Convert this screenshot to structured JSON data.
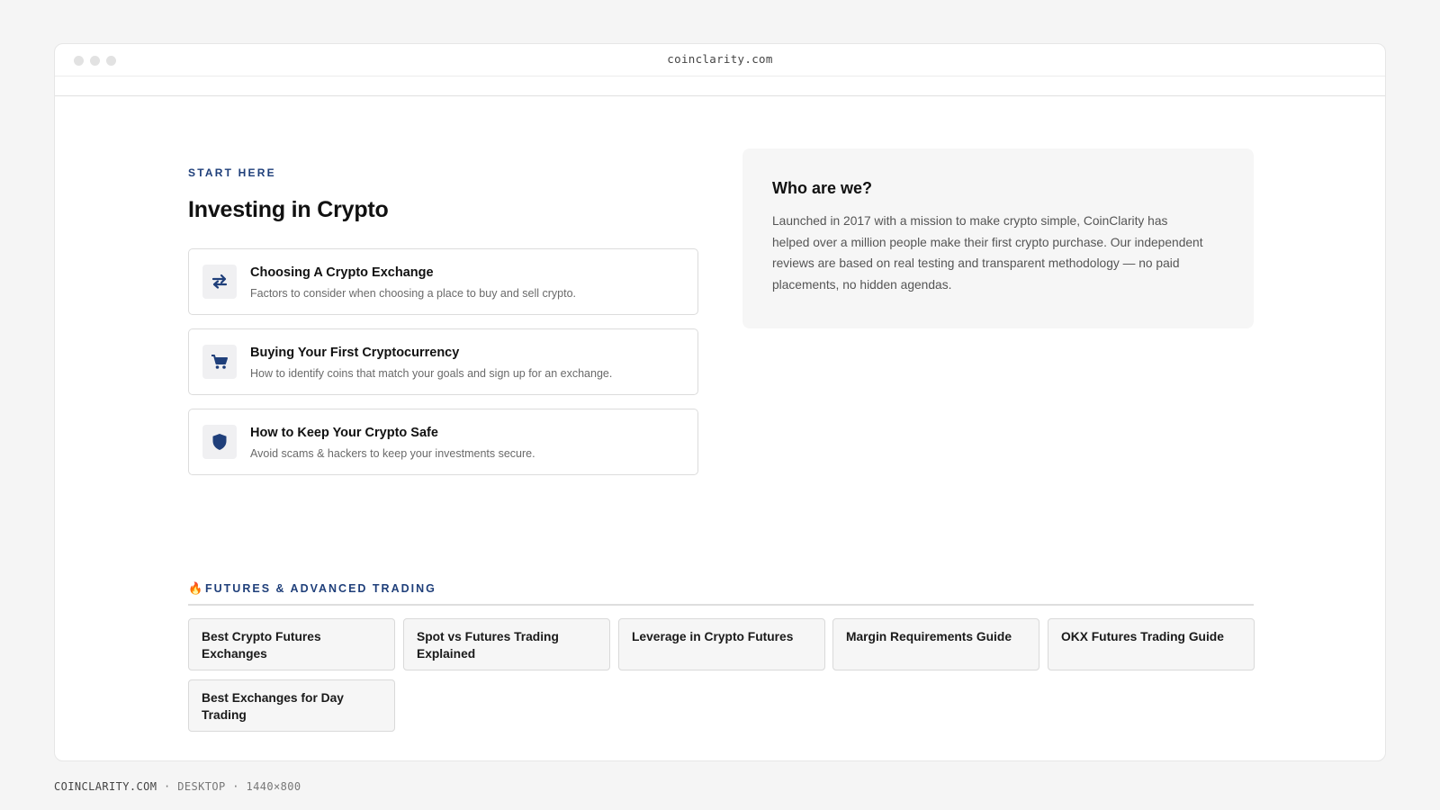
{
  "browser": {
    "url": "coinclarity.com"
  },
  "start": {
    "eyebrow": "START HERE",
    "heading": "Investing in Crypto",
    "guides": [
      {
        "icon": "swap-arrows-icon",
        "title": "Choosing A Crypto Exchange",
        "desc": "Factors to consider when choosing a place to buy and sell crypto."
      },
      {
        "icon": "cart-icon",
        "title": "Buying Your First Cryptocurrency",
        "desc": "How to identify coins that match your goals and sign up for an exchange."
      },
      {
        "icon": "shield-icon",
        "title": "How to Keep Your Crypto Safe",
        "desc": "Avoid scams & hackers to keep your investments secure."
      }
    ]
  },
  "about": {
    "title": "Who are we?",
    "text": "Launched in 2017 with a mission to make crypto simple, CoinClarity has helped over a million people make their first crypto purchase. Our independent reviews are based on real testing and transparent methodology — no paid placements, no hidden agendas."
  },
  "futures": {
    "icon": "fire-icon",
    "title": "FUTURES & ADVANCED TRADING",
    "links": [
      "Best Crypto Futures Exchanges",
      "Spot vs Futures Trading Explained",
      "Leverage in Crypto Futures",
      "Margin Requirements Guide",
      "OKX Futures Trading Guide",
      "Best Exchanges for Day Trading"
    ]
  },
  "footer": {
    "site": "COINCLARITY.COM",
    "separator1": "·",
    "device": "DESKTOP",
    "separator2": "·",
    "size": "1440×800"
  },
  "colors": {
    "accent": "#1f3f7a",
    "background": "#f5f5f5",
    "card": "#f6f6f6"
  }
}
